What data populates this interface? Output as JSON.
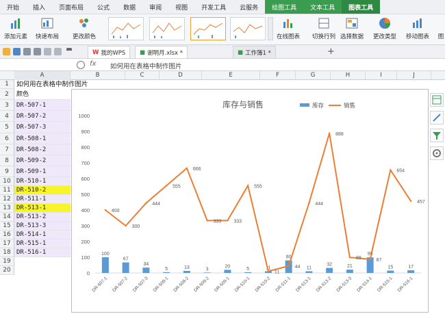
{
  "menu": {
    "tabs": [
      "开始",
      "插入",
      "页面布局",
      "公式",
      "数据",
      "审阅",
      "视图",
      "开发工具",
      "云服务"
    ],
    "green_tabs": [
      "绘图工具",
      "文本工具",
      "图表工具"
    ]
  },
  "ribbon": {
    "add_element": "添加元素",
    "quick_layout": "快速布局",
    "change_color": "更改颜色",
    "online_chart": "在线图表",
    "switch_rowcol": "切换行列",
    "select_data": "选择数据",
    "change_type": "更改类型",
    "move_chart": "移动图表",
    "more": "图"
  },
  "tabs": {
    "mywps": "我的WPS",
    "file1": "谢明月.xlsx *",
    "file2": "工作簿1 *",
    "add": "+"
  },
  "formula": {
    "fx": "fx",
    "text": "如何用在表格中制作图片"
  },
  "columns": [
    "A",
    "B",
    "C",
    "D",
    "E",
    "F",
    "G",
    "H",
    "I",
    "J"
  ],
  "sheet": {
    "rows": [
      "1",
      "2",
      "3",
      "4",
      "5",
      "6",
      "7",
      "8",
      "9",
      "10",
      "11",
      "12",
      "13",
      "14",
      "15",
      "16",
      "17",
      "18",
      "19",
      "20"
    ],
    "a1": "如何用在表格中制作图片",
    "a2": "颜色",
    "a_values": [
      "DR-507-1",
      "DR-507-2",
      "DR-507-3",
      "DR-508-1",
      "DR-508-2",
      "DR-509-2",
      "DR-509-1",
      "DR-510-1",
      "DR-510-2",
      "DR-511-1",
      "DR-513-1",
      "DR-513-2",
      "DR-513-3",
      "DR-514-1",
      "DR-515-1",
      "DR-516-1"
    ]
  },
  "colors": {
    "bar": "#5b9bd5",
    "line": "#ed7d31",
    "highlight": "#f8f42a",
    "selection": "#efe8fb"
  },
  "chart_data": {
    "type": "bar",
    "title": "库存与销售",
    "categories": [
      "DR-507-1",
      "DR-507-2",
      "DR-507-3",
      "DR-508-1",
      "DR-508-2",
      "DR-509-2",
      "DR-509-1",
      "DR-510-1",
      "DR-510-2",
      "DR-511-1",
      "DR-513-1",
      "DR-513-2",
      "DR-513-3",
      "DR-514-1",
      "DR-515-1",
      "DR-516-1"
    ],
    "series": [
      {
        "name": "库存",
        "type": "bar",
        "values": [
          100,
          67,
          34,
          5,
          13,
          3,
          20,
          5,
          11,
          80,
          11,
          32,
          21,
          99,
          15,
          17
        ]
      },
      {
        "name": "销售",
        "type": "line",
        "values": [
          400,
          300,
          444,
          555,
          666,
          333,
          333,
          555,
          11,
          44,
          444,
          888,
          99,
          87,
          654,
          457
        ]
      }
    ],
    "ylim": [
      0,
      1000
    ],
    "yticks": [
      0,
      100,
      200,
      300,
      400,
      500,
      600,
      700,
      800,
      900,
      1000
    ],
    "legend": "top-right",
    "grid": false
  }
}
